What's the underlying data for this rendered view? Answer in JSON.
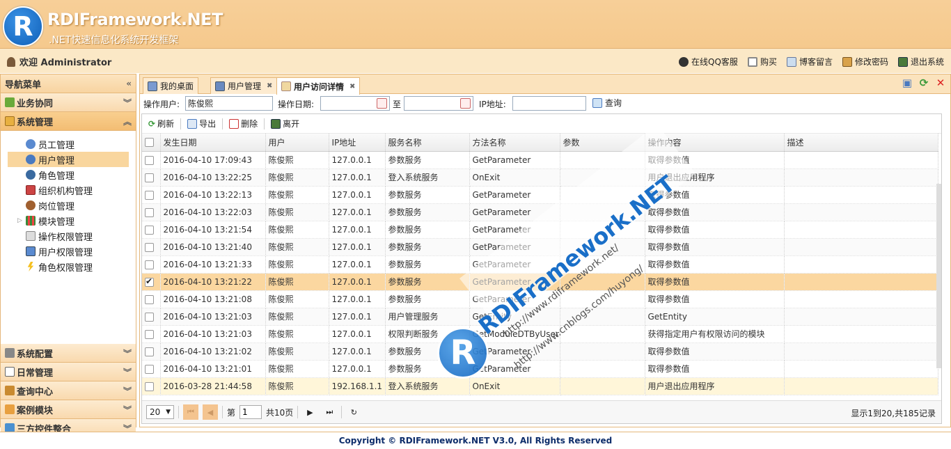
{
  "brand": {
    "logo_letter": "R",
    "title": "RDIFramework.NET",
    "subtitle": ".NET快速信息化系统开发框架"
  },
  "topbar": {
    "welcome": "欢迎 Administrator",
    "links": [
      "在线QQ客服",
      "购买",
      "博客留言",
      "修改密码",
      "退出系统"
    ]
  },
  "nav": {
    "title": "导航菜单",
    "sections_top": [
      "业务协同",
      "系统管理"
    ],
    "tree": [
      "员工管理",
      "用户管理",
      "角色管理",
      "组织机构管理",
      "岗位管理",
      "模块管理",
      "操作权限管理",
      "用户权限管理",
      "角色权限管理"
    ],
    "sections_bottom": [
      "系统配置",
      "日常管理",
      "查询中心",
      "案例模块",
      "三方控件整合"
    ]
  },
  "tabs": [
    "我的桌面",
    "用户管理",
    "用户访问详情"
  ],
  "search": {
    "user_label": "操作用户:",
    "user_value": "陈俊熙",
    "date_label": "操作日期:",
    "to_label": "至",
    "ip_label": "IP地址:",
    "query_label": "查询"
  },
  "toolbar": {
    "refresh": "刷新",
    "export": "导出",
    "delete": "删除",
    "leave": "离开"
  },
  "grid": {
    "columns": [
      "发生日期",
      "用户",
      "IP地址",
      "服务名称",
      "方法名称",
      "参数",
      "操作内容",
      "描述"
    ],
    "rows": [
      [
        "2016-04-10 17:09:43",
        "陈俊熙",
        "127.0.0.1",
        "参数服务",
        "GetParameter",
        "",
        "取得参数值",
        ""
      ],
      [
        "2016-04-10 13:22:25",
        "陈俊熙",
        "127.0.0.1",
        "登入系统服务",
        "OnExit",
        "",
        "用户退出应用程序",
        ""
      ],
      [
        "2016-04-10 13:22:13",
        "陈俊熙",
        "127.0.0.1",
        "参数服务",
        "GetParameter",
        "",
        "取得参数值",
        ""
      ],
      [
        "2016-04-10 13:22:03",
        "陈俊熙",
        "127.0.0.1",
        "参数服务",
        "GetParameter",
        "",
        "取得参数值",
        ""
      ],
      [
        "2016-04-10 13:21:54",
        "陈俊熙",
        "127.0.0.1",
        "参数服务",
        "GetParameter",
        "",
        "取得参数值",
        ""
      ],
      [
        "2016-04-10 13:21:40",
        "陈俊熙",
        "127.0.0.1",
        "参数服务",
        "GetParameter",
        "",
        "取得参数值",
        ""
      ],
      [
        "2016-04-10 13:21:33",
        "陈俊熙",
        "127.0.0.1",
        "参数服务",
        "GetParameter",
        "",
        "取得参数值",
        ""
      ],
      [
        "2016-04-10 13:21:22",
        "陈俊熙",
        "127.0.0.1",
        "参数服务",
        "GetParameter",
        "",
        "取得参数值",
        ""
      ],
      [
        "2016-04-10 13:21:08",
        "陈俊熙",
        "127.0.0.1",
        "参数服务",
        "GetParameter",
        "",
        "取得参数值",
        ""
      ],
      [
        "2016-04-10 13:21:03",
        "陈俊熙",
        "127.0.0.1",
        "用户管理服务",
        "GetEntity",
        "",
        "GetEntity",
        ""
      ],
      [
        "2016-04-10 13:21:03",
        "陈俊熙",
        "127.0.0.1",
        "权限判断服务",
        "GetModuleDTByUserId",
        "",
        "获得指定用户有权限访问的模块",
        ""
      ],
      [
        "2016-04-10 13:21:02",
        "陈俊熙",
        "127.0.0.1",
        "参数服务",
        "GetParameter",
        "",
        "取得参数值",
        ""
      ],
      [
        "2016-04-10 13:21:01",
        "陈俊熙",
        "127.0.0.1",
        "参数服务",
        "GetParameter",
        "",
        "取得参数值",
        ""
      ],
      [
        "2016-03-28 21:44:58",
        "陈俊熙",
        "192.168.1.1",
        "登入系统服务",
        "OnExit",
        "",
        "用户退出应用程序",
        ""
      ]
    ]
  },
  "pager": {
    "page_size": "20",
    "page_label": "第",
    "page_value": "1",
    "total_pages": "共10页",
    "info": "显示1到20,共185记录"
  },
  "watermark": {
    "logo_letter": "R",
    "brand": "RDIFramework.NET",
    "url1": "http://www.rdiframework.net/",
    "url2": "http://www.cnblogs.com/huyong/"
  },
  "footer": "Copyright © RDIFramework.NET V3.0, All Rights Reserved",
  "colors": {
    "header_bg": "#f5c98d",
    "accent_border": "#e5b77a",
    "selected_row": "#fbd7a0",
    "footer_text": "#0e2e6b"
  }
}
